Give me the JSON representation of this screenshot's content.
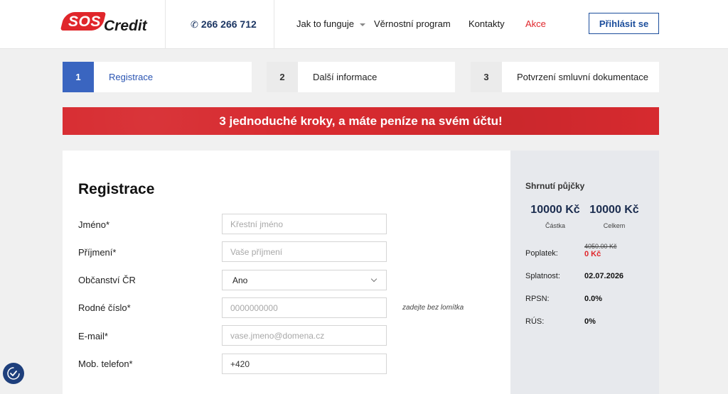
{
  "header": {
    "logo_sos": "SOS",
    "logo_credit": "Credit",
    "phone": "266 266 712",
    "nav": {
      "how_it_works": "Jak to funguje",
      "loyalty": "Věrnostní program",
      "contacts": "Kontakty",
      "promo": "Akce"
    },
    "login": "Přihlásit se"
  },
  "steps": [
    {
      "num": "1",
      "label": "Registrace"
    },
    {
      "num": "2",
      "label": "Další informace"
    },
    {
      "num": "3",
      "label": "Potvrzení smluvní dokumentace"
    }
  ],
  "banner": "3 jednoduché kroky, a máte peníze na svém účtu!",
  "form": {
    "title": "Registrace",
    "fields": {
      "first_name": {
        "label": "Jméno*",
        "placeholder": "Křestní jméno"
      },
      "last_name": {
        "label": "Příjmení*",
        "placeholder": "Vaše příjmení"
      },
      "citizenship": {
        "label": "Občanství ČR",
        "value": "Ano"
      },
      "birth_number": {
        "label": "Rodné číslo*",
        "placeholder": "0000000000",
        "hint": "zadejte bez lomítka"
      },
      "email": {
        "label": "E-mail*",
        "placeholder": "vase.jmeno@domena.cz"
      },
      "phone": {
        "label": "Mob. telefon*",
        "value": "+420"
      }
    }
  },
  "summary": {
    "title": "Shrnutí půjčky",
    "amount": {
      "value": "10000 Kč",
      "label": "Částka"
    },
    "total": {
      "value": "10000 Kč",
      "label": "Celkem"
    },
    "fee": {
      "label": "Poplatek:",
      "old": "4050.00 Kč",
      "new": "0 Kč"
    },
    "due": {
      "label": "Splatnost:",
      "value": "02.07.2026"
    },
    "rpsn": {
      "label": "RPSN:",
      "value": "0.0%"
    },
    "rus": {
      "label": "RÚS:",
      "value": "0%"
    }
  },
  "colors": {
    "brand_red": "#e0262b",
    "brand_blue": "#3a65c0",
    "navy": "#1c3663"
  }
}
